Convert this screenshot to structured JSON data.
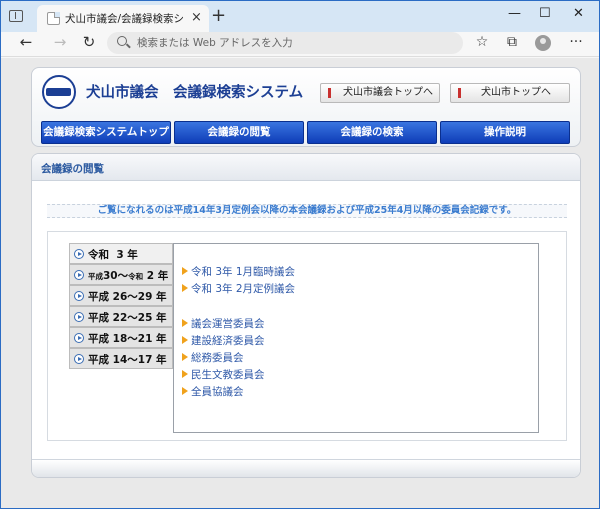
{
  "browser": {
    "tab_title": "犬山市議会/会議録検索システム",
    "tab_close": "×",
    "new_tab": "+",
    "address_placeholder": "検索または Web アドレスを入力",
    "controls": {
      "minimize": "—",
      "maximize": "☐",
      "close": "✕"
    },
    "nav": {
      "back": "←",
      "forward": "→",
      "reload": "↻"
    },
    "icons": {
      "favorites": "☆",
      "collections": "⧉",
      "menu": "···"
    }
  },
  "header": {
    "title": "犬山市議会　会議録検索システム",
    "links": [
      {
        "label": "犬山市議会トップへ"
      },
      {
        "label": "犬山市トップへ"
      }
    ],
    "nav_tabs": [
      {
        "label": "会議録検索システムトップ"
      },
      {
        "label": "会議録の閲覧"
      },
      {
        "label": "会議録の検索"
      },
      {
        "label": "操作説明"
      }
    ]
  },
  "content": {
    "section_title": "会議録の閲覧",
    "notice": "ご覧になれるのは平成14年3月定例会以降の本会議録および平成25年4月以降の委員会記録です。",
    "years": [
      {
        "era": "令和",
        "range": "3",
        "suffix": "年"
      },
      {
        "era_small": "平成",
        "range_a": "30～",
        "era2_small": "令和",
        "range_b": "2",
        "suffix": "年"
      },
      {
        "era": "平成",
        "range": "26～29",
        "suffix": "年"
      },
      {
        "era": "平成",
        "range": "22～25",
        "suffix": "年"
      },
      {
        "era": "平成",
        "range": "18～21",
        "suffix": "年"
      },
      {
        "era": "平成",
        "range": "14～17",
        "suffix": "年"
      }
    ],
    "meetings": [
      {
        "label": "令和 3年 1月臨時議会"
      },
      {
        "label": "令和 3年 2月定例議会"
      },
      {
        "label": "議会運営委員会"
      },
      {
        "label": "建設経済委員会"
      },
      {
        "label": "総務委員会"
      },
      {
        "label": "民生文教委員会"
      },
      {
        "label": "全員協議会"
      }
    ]
  }
}
